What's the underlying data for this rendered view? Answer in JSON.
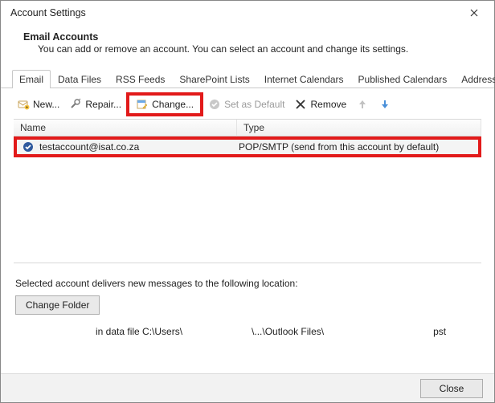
{
  "window": {
    "title": "Account Settings"
  },
  "header": {
    "title": "Email Accounts",
    "description": "You can add or remove an account. You can select an account and change its settings."
  },
  "tabs": [
    {
      "label": "Email",
      "active": true
    },
    {
      "label": "Data Files",
      "active": false
    },
    {
      "label": "RSS Feeds",
      "active": false
    },
    {
      "label": "SharePoint Lists",
      "active": false
    },
    {
      "label": "Internet Calendars",
      "active": false
    },
    {
      "label": "Published Calendars",
      "active": false
    },
    {
      "label": "Address Books",
      "active": false
    }
  ],
  "toolbar": {
    "new": "New...",
    "repair": "Repair...",
    "change": "Change...",
    "set_default": "Set as Default",
    "remove": "Remove"
  },
  "columns": {
    "name": "Name",
    "type": "Type"
  },
  "accounts": [
    {
      "name": "testaccount@isat.co.za",
      "type": "POP/SMTP (send from this account by default)",
      "default": true
    }
  ],
  "delivery": {
    "label": "Selected account delivers new messages to the following location:",
    "change_folder": "Change Folder",
    "path_prefix": "in data file C:\\Users\\",
    "path_mid": "\\...\\Outlook Files\\",
    "path_suffix": "pst"
  },
  "footer": {
    "close": "Close"
  }
}
